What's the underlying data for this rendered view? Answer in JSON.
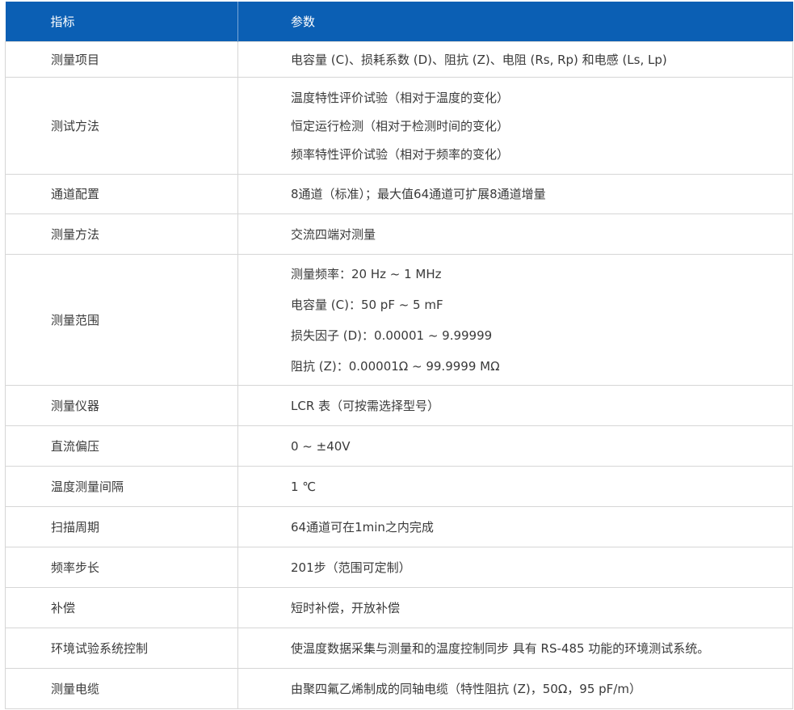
{
  "header": {
    "col_indicator": "指标",
    "col_parameter": "参数"
  },
  "rows": [
    {
      "label": "测量项目",
      "values": [
        "电容量 (C)、损耗系数 (D)、阻抗 (Z)、电阻 (Rs, Rp) 和电感 (Ls, Lp)"
      ]
    },
    {
      "label": "测试方法",
      "values": [
        "温度特性评价试验（相对于温度的变化）",
        "恒定运行检测（相对于检测时间的变化）",
        "频率特性评价试验（相对于频率的变化）"
      ]
    },
    {
      "label": "通道配置",
      "values": [
        "8通道（标准）；最大值64通道可扩展8通道增量"
      ]
    },
    {
      "label": "测量方法",
      "values": [
        "交流四端对测量"
      ]
    },
    {
      "label": "测量范围",
      "values": [
        "测量频率：20 Hz ~ 1 MHz",
        "电容量 (C)：50 pF ~ 5 mF",
        "损失因子 (D)：0.00001 ~ 9.99999",
        "阻抗 (Z)：0.00001Ω ~ 99.9999 MΩ"
      ]
    },
    {
      "label": "测量仪器",
      "values": [
        "LCR 表（可按需选择型号）"
      ]
    },
    {
      "label": "直流偏压",
      "values": [
        "0 ~ ±40V"
      ]
    },
    {
      "label": "温度测量间隔",
      "values": [
        "1 ℃"
      ]
    },
    {
      "label": "扫描周期",
      "values": [
        "64通道可在1min之内完成"
      ]
    },
    {
      "label": "频率步长",
      "values": [
        "201步（范围可定制）"
      ]
    },
    {
      "label": "补偿",
      "values": [
        "短时补偿，开放补偿"
      ]
    },
    {
      "label": "环境试验系统控制",
      "values": [
        "使温度数据采集与测量和的温度控制同步 具有 RS-485 功能的环境测试系统。"
      ]
    },
    {
      "label": "测量电缆",
      "values": [
        "由聚四氟乙烯制成的同轴电缆（特性阻抗 (Z)，50Ω，95 pF/m）"
      ]
    }
  ]
}
